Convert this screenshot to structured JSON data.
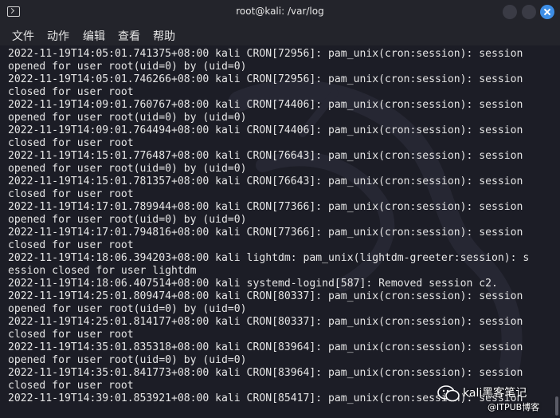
{
  "window": {
    "title": "root@kali: /var/log"
  },
  "menu": {
    "file": "文件",
    "actions": "动作",
    "edit": "编辑",
    "view": "查看",
    "help": "帮助"
  },
  "terminal": {
    "lines": [
      "2022-11-19T14:05:01.741375+08:00 kali CRON[72956]: pam_unix(cron:session): session",
      "opened for user root(uid=0) by (uid=0)",
      "2022-11-19T14:05:01.746266+08:00 kali CRON[72956]: pam_unix(cron:session): session",
      "closed for user root",
      "2022-11-19T14:09:01.760767+08:00 kali CRON[74406]: pam_unix(cron:session): session",
      "opened for user root(uid=0) by (uid=0)",
      "2022-11-19T14:09:01.764494+08:00 kali CRON[74406]: pam_unix(cron:session): session",
      "closed for user root",
      "2022-11-19T14:15:01.776487+08:00 kali CRON[76643]: pam_unix(cron:session): session",
      "opened for user root(uid=0) by (uid=0)",
      "2022-11-19T14:15:01.781357+08:00 kali CRON[76643]: pam_unix(cron:session): session",
      "closed for user root",
      "2022-11-19T14:17:01.789944+08:00 kali CRON[77366]: pam_unix(cron:session): session",
      "opened for user root(uid=0) by (uid=0)",
      "2022-11-19T14:17:01.794816+08:00 kali CRON[77366]: pam_unix(cron:session): session",
      "closed for user root",
      "2022-11-19T14:18:06.394203+08:00 kali lightdm: pam_unix(lightdm-greeter:session): s",
      "ession closed for user lightdm",
      "2022-11-19T14:18:06.407514+08:00 kali systemd-logind[587]: Removed session c2.",
      "2022-11-19T14:25:01.809474+08:00 kali CRON[80337]: pam_unix(cron:session): session",
      "opened for user root(uid=0) by (uid=0)",
      "2022-11-19T14:25:01.814177+08:00 kali CRON[80337]: pam_unix(cron:session): session",
      "closed for user root",
      "2022-11-19T14:35:01.835318+08:00 kali CRON[83964]: pam_unix(cron:session): session",
      "opened for user root(uid=0) by (uid=0)",
      "2022-11-19T14:35:01.841773+08:00 kali CRON[83964]: pam_unix(cron:session): session",
      "closed for user root",
      "2022-11-19T14:39:01.853921+08:00 kali CRON[85417]: pam_unix(cron:session): session"
    ]
  },
  "watermark": {
    "name": "kali黑客笔记",
    "sub": "@ITPUB博客"
  },
  "colors": {
    "terminal_bg": "#1c1d26",
    "terminal_text": "#e6e6e6",
    "close_button": "#3d8ee6"
  }
}
